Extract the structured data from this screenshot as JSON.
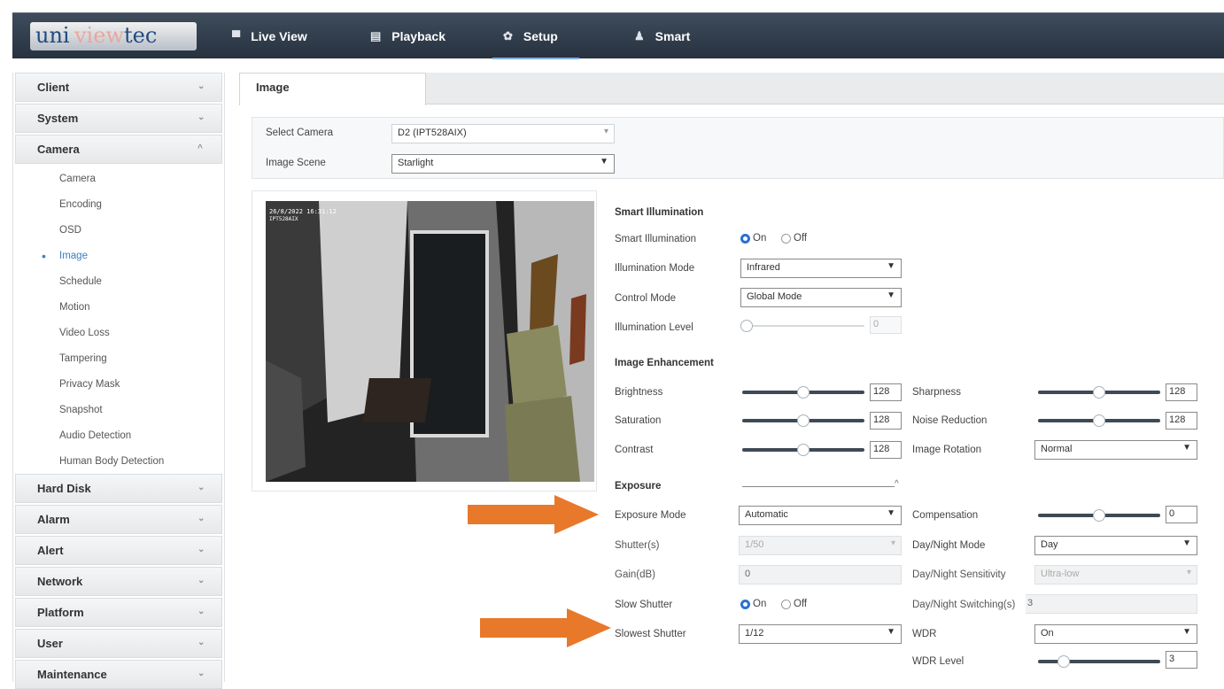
{
  "header": {
    "logo": {
      "part1": "uni",
      "part2": "view",
      "part3": " tec"
    },
    "nav": [
      {
        "label": "Live View",
        "icon": "monitor-icon"
      },
      {
        "label": "Playback",
        "icon": "film-icon"
      },
      {
        "label": "Setup",
        "icon": "gear-icon"
      },
      {
        "label": "Smart",
        "icon": "person-icon"
      }
    ]
  },
  "sidebar": {
    "groups": [
      {
        "label": "Client"
      },
      {
        "label": "System"
      },
      {
        "label": "Camera"
      },
      {
        "label": "Hard Disk"
      },
      {
        "label": "Alarm"
      },
      {
        "label": "Alert"
      },
      {
        "label": "Network"
      },
      {
        "label": "Platform"
      },
      {
        "label": "User"
      },
      {
        "label": "Maintenance"
      }
    ],
    "camera_items": [
      "Camera",
      "Encoding",
      "OSD",
      "Image",
      "Schedule",
      "Motion",
      "Video Loss",
      "Tampering",
      "Privacy Mask",
      "Snapshot",
      "Audio Detection",
      "Human Body Detection"
    ],
    "active_item": "Image"
  },
  "main": {
    "tab": "Image",
    "select_camera_label": "Select Camera",
    "select_camera_value": "D2 (IPT528AIX)",
    "image_scene_label": "Image Scene",
    "image_scene_value": "Starlight",
    "preview": {
      "timestamp": "26/8/2022  16:31:12",
      "channel": "IPT528AIX"
    },
    "smart_illumination": {
      "title": "Smart Illumination",
      "label": "Smart Illumination",
      "on": "On",
      "off": "Off",
      "mode_label": "Illumination Mode",
      "mode_value": "Infrared",
      "control_label": "Control Mode",
      "control_value": "Global Mode",
      "level_label": "Illumination Level",
      "level_value": "0"
    },
    "image_enhancement": {
      "title": "Image Enhancement",
      "brightness_label": "Brightness",
      "brightness_value": "128",
      "saturation_label": "Saturation",
      "saturation_value": "128",
      "contrast_label": "Contrast",
      "contrast_value": "128",
      "sharpness_label": "Sharpness",
      "sharpness_value": "128",
      "noise_label": "Noise Reduction",
      "noise_value": "128",
      "rotation_label": "Image Rotation",
      "rotation_value": "Normal"
    },
    "exposure": {
      "title": "Exposure",
      "mode_label": "Exposure Mode",
      "mode_value": "Automatic",
      "shutter_label": "Shutter(s)",
      "shutter_value": "1/50",
      "gain_label": "Gain(dB)",
      "gain_value": "0",
      "slow_shutter_label": "Slow Shutter",
      "on": "On",
      "off": "Off",
      "slowest_label": "Slowest Shutter",
      "slowest_value": "1/12",
      "compensation_label": "Compensation",
      "compensation_value": "0",
      "daynight_label": "Day/Night Mode",
      "daynight_value": "Day",
      "sensitivity_label": "Day/Night Sensitivity",
      "sensitivity_value": "Ultra-low",
      "switching_label": "Day/Night Switching(s)",
      "switching_value": "3",
      "wdr_label": "WDR",
      "wdr_value": "On",
      "wdr_level_label": "WDR Level",
      "wdr_level_value": "3"
    },
    "annotation_color": "#e8782a"
  }
}
